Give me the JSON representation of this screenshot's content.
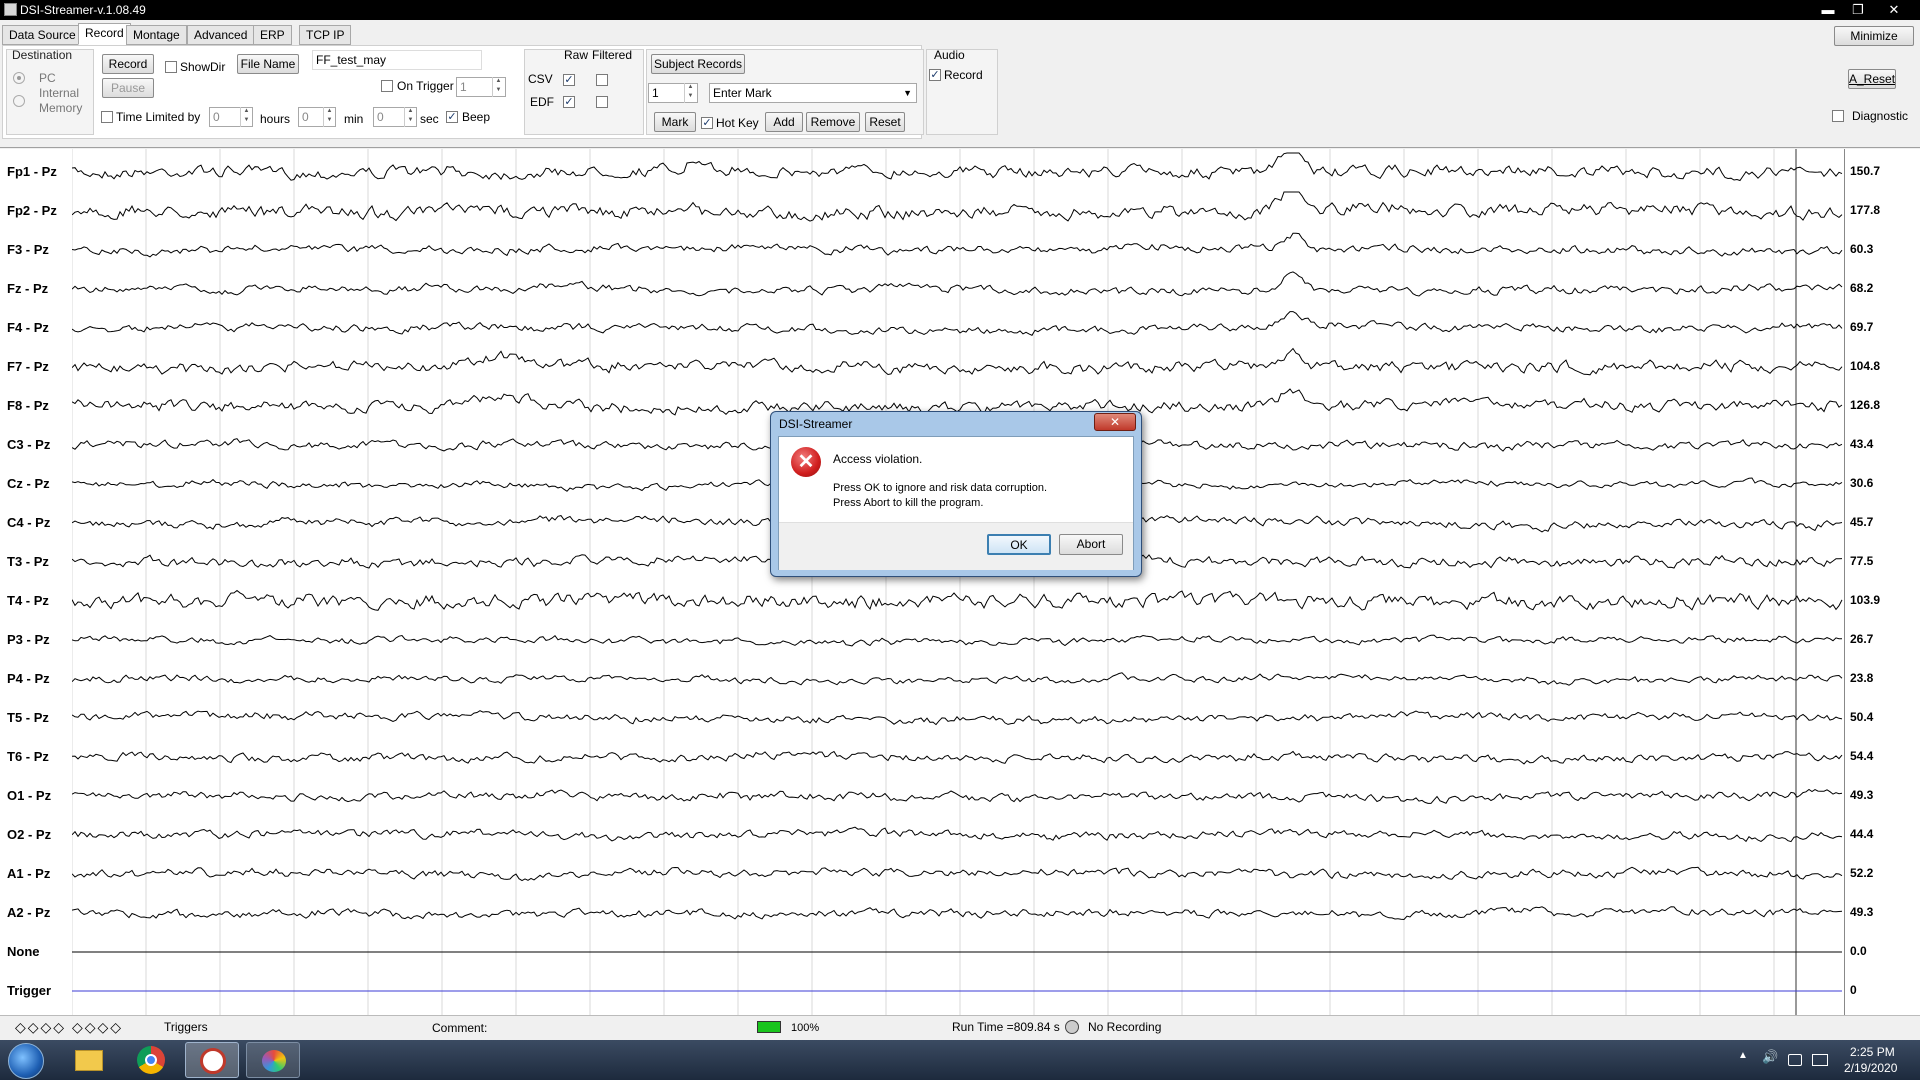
{
  "window": {
    "title": "DSI-Streamer-v.1.08.49",
    "min_glyph": "▬",
    "max_glyph": "❐",
    "close_glyph": "✕"
  },
  "tabs": [
    "Data Source",
    "Record",
    "Montage",
    "Advanced",
    "ERP",
    "TCP IP"
  ],
  "record": {
    "destination_label": "Destination",
    "pc_label": "PC",
    "internal_label": "Internal",
    "memory_label": "Memory",
    "record_btn": "Record",
    "pause_btn": "Pause",
    "showdir_label": "ShowDir",
    "filename_btn": "File Name",
    "filename_value": "FF_test_may",
    "on_trigger_label": "On Trigger",
    "on_trigger_value": "1",
    "time_limited_label": "Time Limited by",
    "hours_value": "0",
    "hours_label": "hours",
    "min_value": "0",
    "min_label": "min",
    "sec_value": "0",
    "sec_label": "sec",
    "beep_label": "Beep"
  },
  "formats": {
    "raw_label": "Raw",
    "filtered_label": "Filtered",
    "csv_label": "CSV",
    "edf_label": "EDF"
  },
  "subject": {
    "subject_records_btn": "Subject Records",
    "mark_number": "1",
    "mark_select": "Enter Mark",
    "mark_btn": "Mark",
    "hotkey_label": "Hot Key",
    "add_btn": "Add",
    "remove_btn": "Remove",
    "reset_btn": "Reset"
  },
  "audio": {
    "audio_label": "Audio",
    "record_label": "Record"
  },
  "right": {
    "minimize_btn": "Minimize",
    "areset_btn": "A_Reset",
    "diagnostic_label": "Diagnostic"
  },
  "channels": [
    {
      "name": "Fp1 - Pz",
      "value": "150.7"
    },
    {
      "name": "Fp2 - Pz",
      "value": "177.8"
    },
    {
      "name": "F3 - Pz",
      "value": "60.3"
    },
    {
      "name": "Fz - Pz",
      "value": "68.2"
    },
    {
      "name": "F4 - Pz",
      "value": "69.7"
    },
    {
      "name": "F7 - Pz",
      "value": "104.8"
    },
    {
      "name": "F8 - Pz",
      "value": "126.8"
    },
    {
      "name": "C3 - Pz",
      "value": "43.4"
    },
    {
      "name": "Cz - Pz",
      "value": "30.6"
    },
    {
      "name": "C4 - Pz",
      "value": "45.7"
    },
    {
      "name": "T3 - Pz",
      "value": "77.5"
    },
    {
      "name": "T4 - Pz",
      "value": "103.9"
    },
    {
      "name": "P3 - Pz",
      "value": "26.7"
    },
    {
      "name": "P4 - Pz",
      "value": "23.8"
    },
    {
      "name": "T5 - Pz",
      "value": "50.4"
    },
    {
      "name": "T6 - Pz",
      "value": "54.4"
    },
    {
      "name": "O1 - Pz",
      "value": "49.3"
    },
    {
      "name": "O2 - Pz",
      "value": "44.4"
    },
    {
      "name": "A1 - Pz",
      "value": "52.2"
    },
    {
      "name": "A2 - Pz",
      "value": "49.3"
    },
    {
      "name": "None",
      "value": "0.0"
    },
    {
      "name": "Trigger",
      "value": "0"
    }
  ],
  "status": {
    "nav_glyphs": "◇◇◇◇   ◇◇◇◇",
    "triggers_label": "Triggers",
    "comment_label": "Comment:",
    "battery_percent": "100%",
    "run_time": "Run Time =809.84 s",
    "recording_status": "No Recording"
  },
  "taskbar": {
    "time": "2:25 PM",
    "date": "2/19/2020"
  },
  "dialog": {
    "title": "DSI-Streamer",
    "message": "Access violation.",
    "line1": "Press OK to ignore and risk data corruption.",
    "line2": "Press Abort to kill the program.",
    "ok_btn": "OK",
    "abort_btn": "Abort",
    "close_glyph": "✕"
  },
  "colors": {
    "trace": "#000000",
    "trigger_line": "#3b3bd6",
    "dialog_error": "#d01e1e",
    "battery": "#19c41d"
  }
}
